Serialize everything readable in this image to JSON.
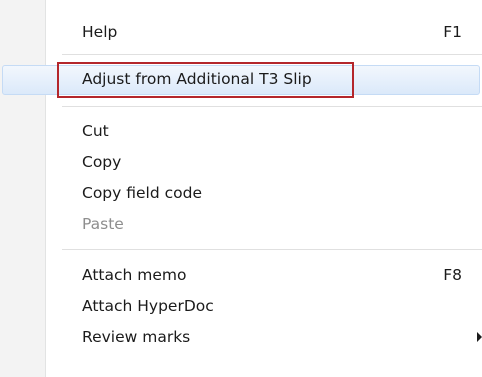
{
  "menu": {
    "help": {
      "label": "Help",
      "shortcut": "F1"
    },
    "adjust": {
      "label": "Adjust from Additional T3 Slip"
    },
    "cut": {
      "label": "Cut"
    },
    "copy": {
      "label": "Copy"
    },
    "copy_field_code": {
      "label": "Copy field code"
    },
    "paste": {
      "label": "Paste"
    },
    "attach_memo": {
      "label": "Attach memo",
      "shortcut": "F8"
    },
    "attach_hyperdoc": {
      "label": "Attach HyperDoc"
    },
    "review_marks": {
      "label": "Review marks",
      "submenu_icon": "chevron-right-icon"
    }
  },
  "colors": {
    "highlight_border": "#b4262b",
    "hover_background": "#dbe9fa",
    "disabled_text": "#8e8e8e"
  }
}
